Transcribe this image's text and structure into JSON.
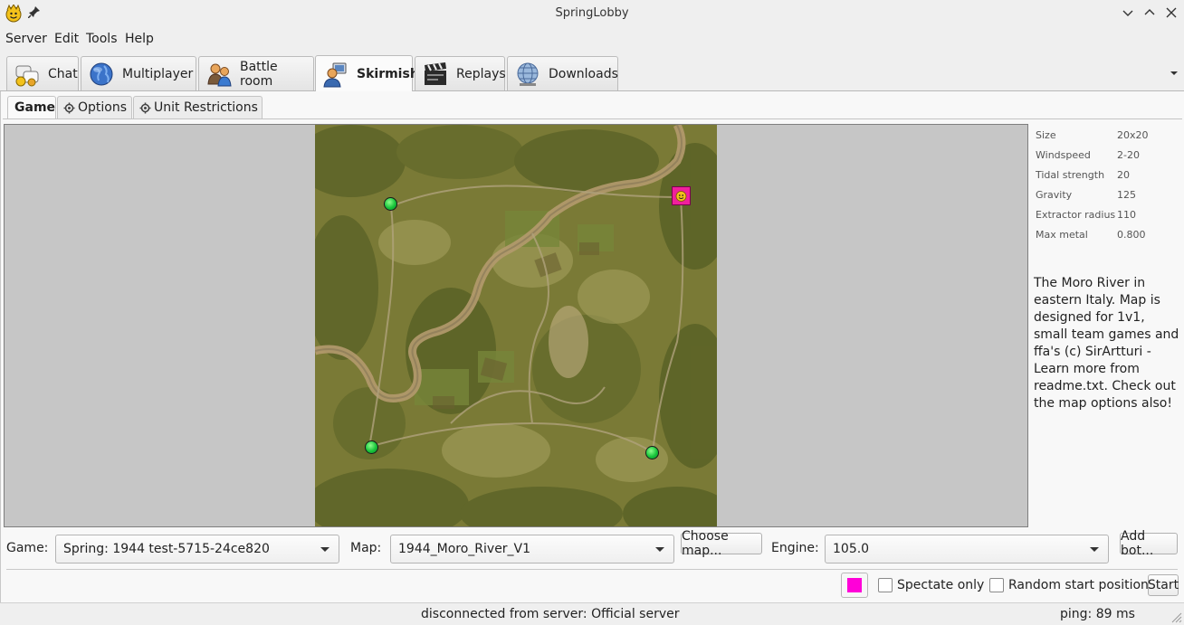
{
  "window": {
    "title": "SpringLobby"
  },
  "menu": [
    "Server",
    "Edit",
    "Tools",
    "Help"
  ],
  "tabs": [
    {
      "label": "Chat",
      "icon": "chat-icon"
    },
    {
      "label": "Multiplayer",
      "icon": "globe-icon"
    },
    {
      "label": "Battle room",
      "icon": "users-icon"
    },
    {
      "label": "Skirmish",
      "icon": "skirmish-user-icon",
      "active": true
    },
    {
      "label": "Replays",
      "icon": "clapperboard-icon"
    },
    {
      "label": "Downloads",
      "icon": "download-globe-icon"
    }
  ],
  "subtabs": [
    {
      "label": "Game",
      "active": true
    },
    {
      "label": "Options",
      "icon": "gear-icon"
    },
    {
      "label": "Unit Restrictions",
      "icon": "gear-icon"
    }
  ],
  "map_info": [
    {
      "key": "Size",
      "value": "20x20"
    },
    {
      "key": "Windspeed",
      "value": "2-20"
    },
    {
      "key": "Tidal strength",
      "value": "20"
    },
    {
      "key": "Gravity",
      "value": "125"
    },
    {
      "key": "Extractor radius",
      "value": "110"
    },
    {
      "key": "Max metal",
      "value": "0.800"
    }
  ],
  "map_description": "The Moro River in eastern Italy. Map is designed for 1v1, small team games and ffa's (c) SirArtturi - Learn more from readme.txt. Check out the map options also!",
  "controls": {
    "game_label": "Game:",
    "game_value": "Spring: 1944 test-5715-24ce820",
    "map_label": "Map:",
    "map_value": "1944_Moro_River_V1",
    "choose_map": "Choose map...",
    "engine_label": "Engine:",
    "engine_value": "105.0",
    "add_bot": "Add bot...",
    "spectate_only": "Spectate only",
    "random_start": "Random start positions",
    "start": "Start",
    "player_color": "#ff00d8"
  },
  "status": {
    "message": "disconnected from server: Official server",
    "ping": "ping: 89 ms"
  }
}
